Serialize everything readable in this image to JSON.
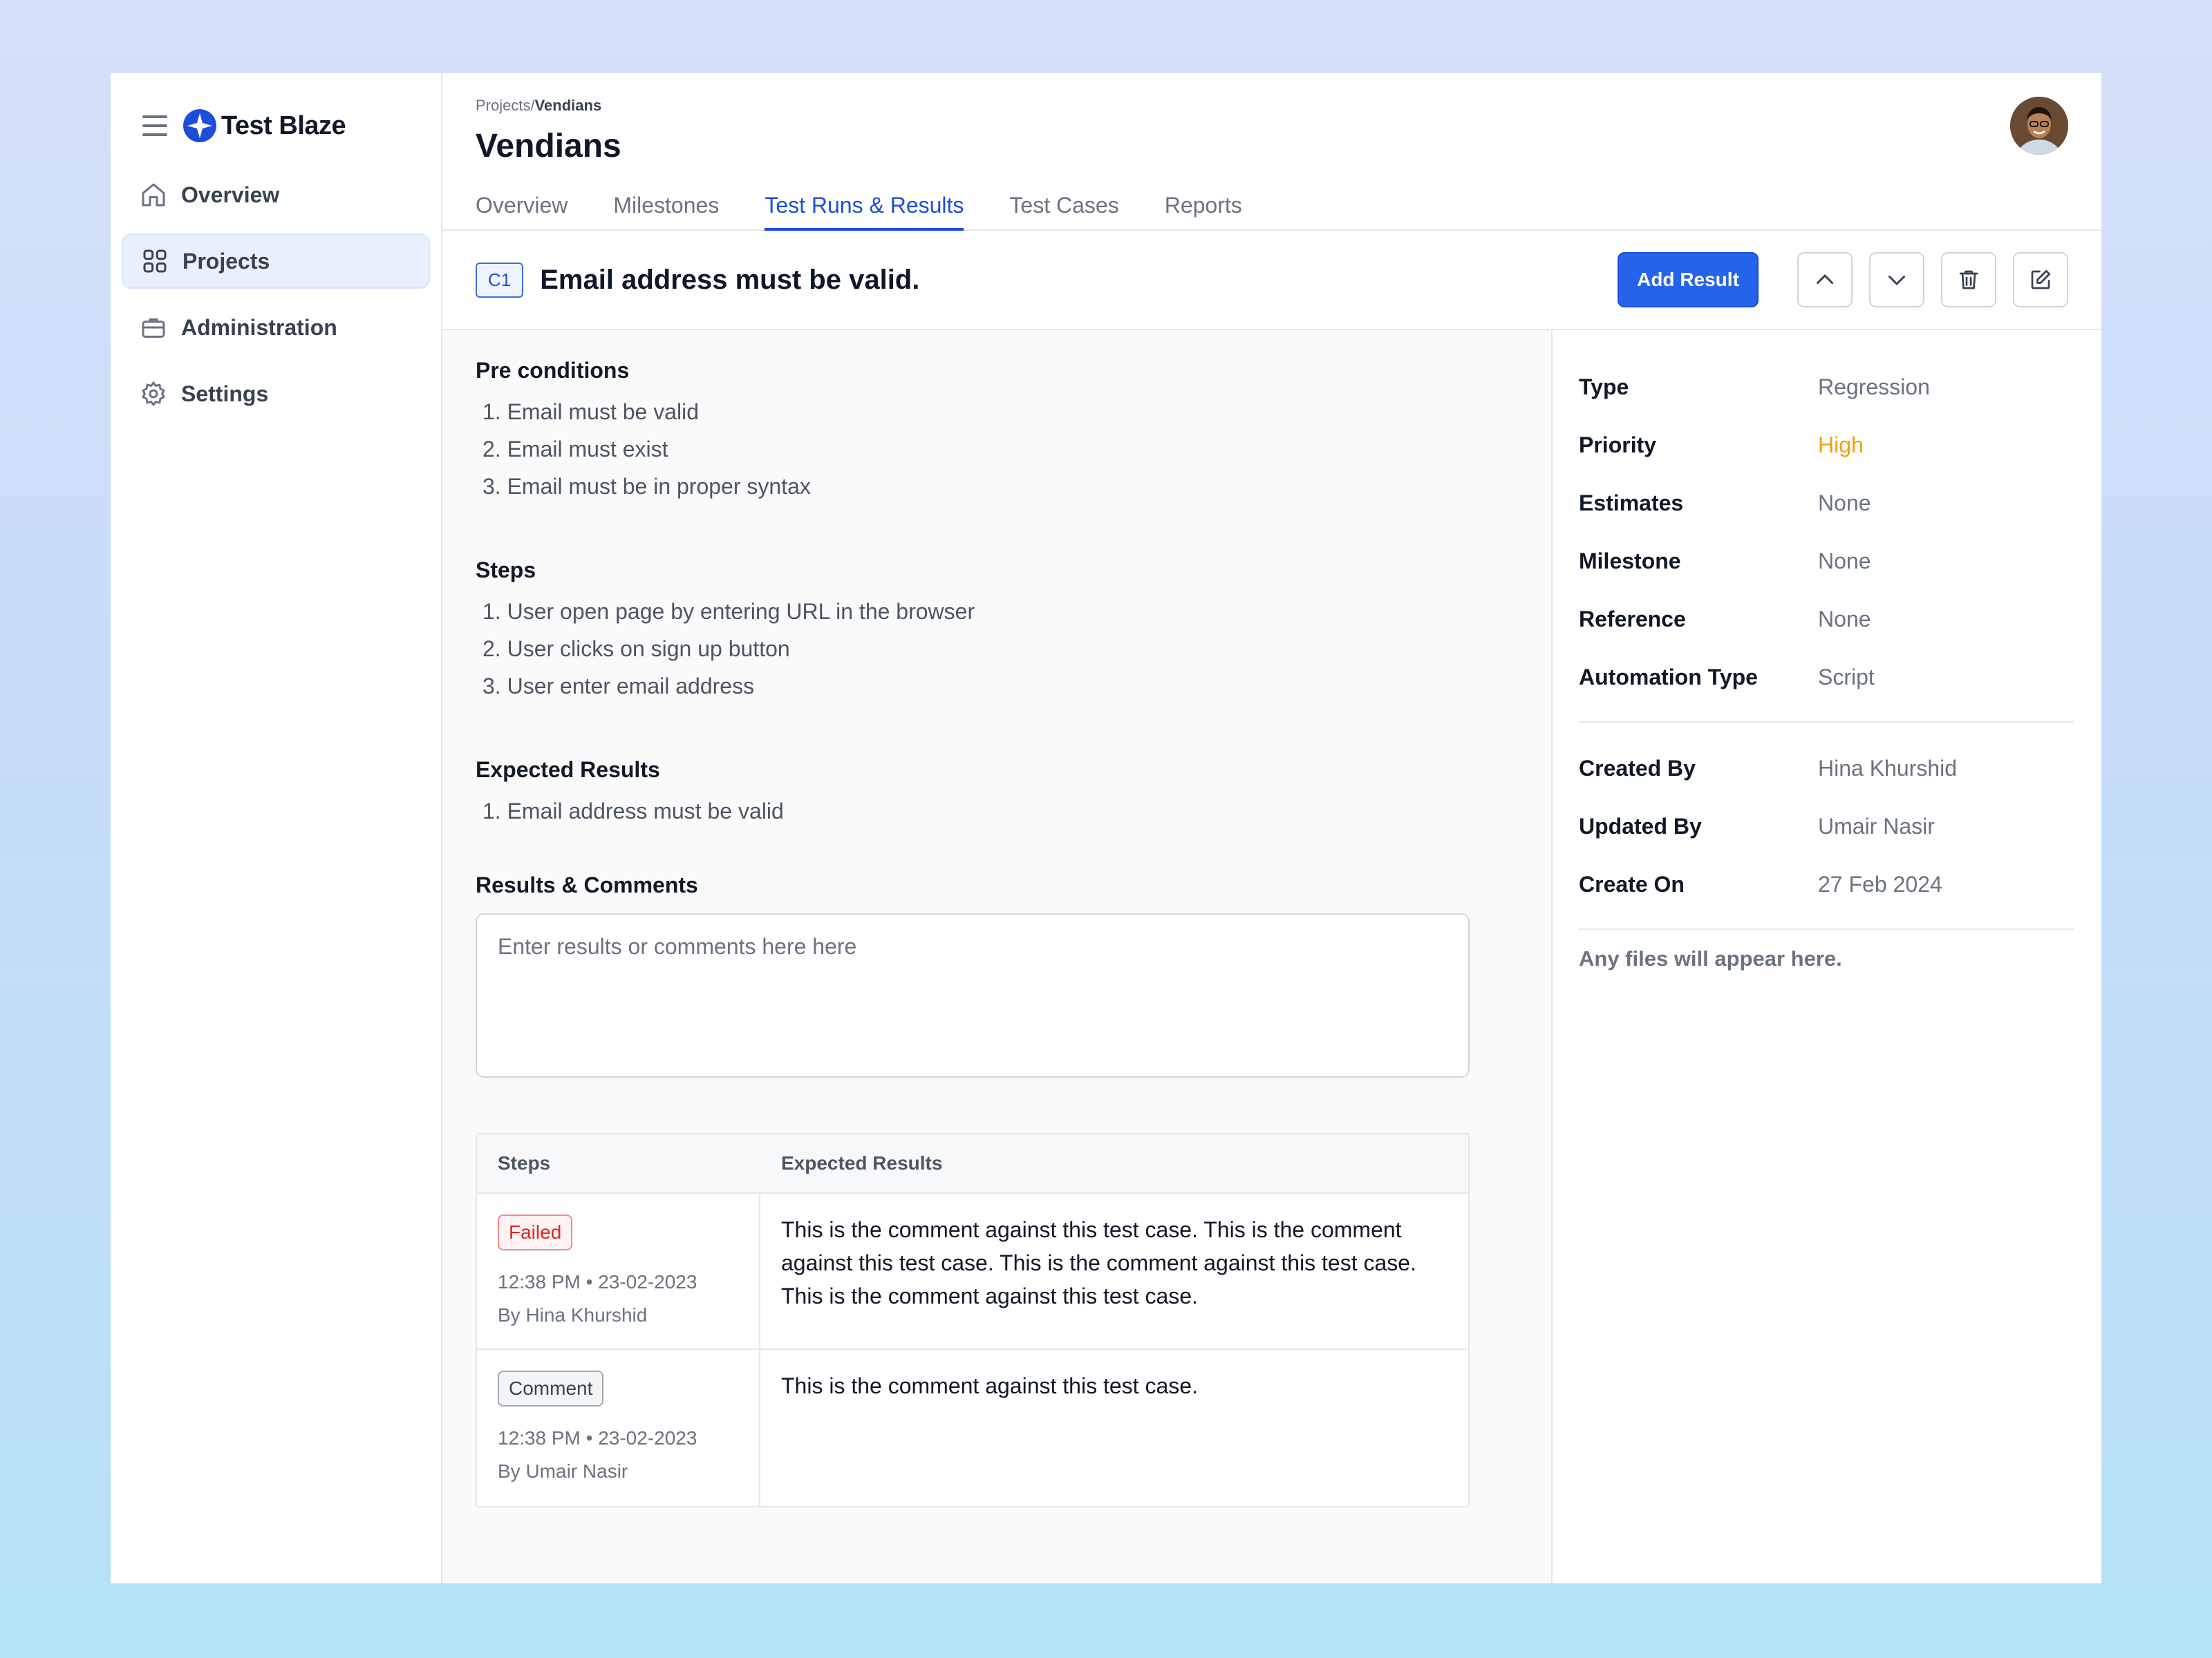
{
  "brand": {
    "name": "Test Blaze"
  },
  "sidebar": {
    "items": [
      {
        "label": "Overview",
        "icon": "home-icon"
      },
      {
        "label": "Projects",
        "icon": "grid-icon",
        "active": true
      },
      {
        "label": "Administration",
        "icon": "briefcase-icon"
      },
      {
        "label": "Settings",
        "icon": "gear-icon"
      }
    ]
  },
  "header": {
    "breadcrumb_parent": "Projects/",
    "breadcrumb_current": "Vendians",
    "title": "Vendians",
    "tabs": [
      "Overview",
      "Milestones",
      "Test Runs & Results",
      "Test Cases",
      "Reports"
    ],
    "active_tab": "Test Runs & Results"
  },
  "case": {
    "id": "C1",
    "title": "Email address must be valid.",
    "add_result_label": "Add Result"
  },
  "details": {
    "preconditions_title": "Pre conditions",
    "preconditions": [
      "1. Email must be valid",
      "2. Email must exist",
      "3. Email must be in proper syntax"
    ],
    "steps_title": "Steps",
    "steps": [
      "1. User open page by entering URL in the browser",
      "2. User clicks on sign up button",
      "3. User enter email address"
    ],
    "expected_title": "Expected Results",
    "expected": [
      "1. Email address must be valid"
    ],
    "results_title": "Results & Comments",
    "results_placeholder": "Enter results or comments here here"
  },
  "results_table": {
    "headers": [
      "Steps",
      "Expected Results"
    ],
    "rows": [
      {
        "status": "Failed",
        "time": "12:38 PM • 23-02-2023",
        "by": "By Hina Khurshid",
        "text": "This is the comment against this test case. This is the comment against this test case. This is the comment against this test case. This is the comment against this test case."
      },
      {
        "status": "Comment",
        "time": "12:38 PM • 23-02-2023",
        "by": "By Umair Nasir",
        "text": "This is the comment against this test case."
      }
    ]
  },
  "properties": [
    {
      "key": "Type",
      "value": "Regression"
    },
    {
      "key": "Priority",
      "value": "High"
    },
    {
      "key": "Estimates",
      "value": "None"
    },
    {
      "key": "Milestone",
      "value": "None"
    },
    {
      "key": "Reference",
      "value": "None"
    },
    {
      "key": "Automation Type",
      "value": "Script"
    }
  ],
  "audit": [
    {
      "key": "Created By",
      "value": "Hina Khurshid"
    },
    {
      "key": "Updated By",
      "value": "Umair Nasir"
    },
    {
      "key": "Create On",
      "value": "27 Feb 2024"
    }
  ],
  "files_note": "Any files will appear here.",
  "colors": {
    "accent": "#2563eb",
    "priority_high": "#f59e0b",
    "failed": "#dc2626"
  }
}
